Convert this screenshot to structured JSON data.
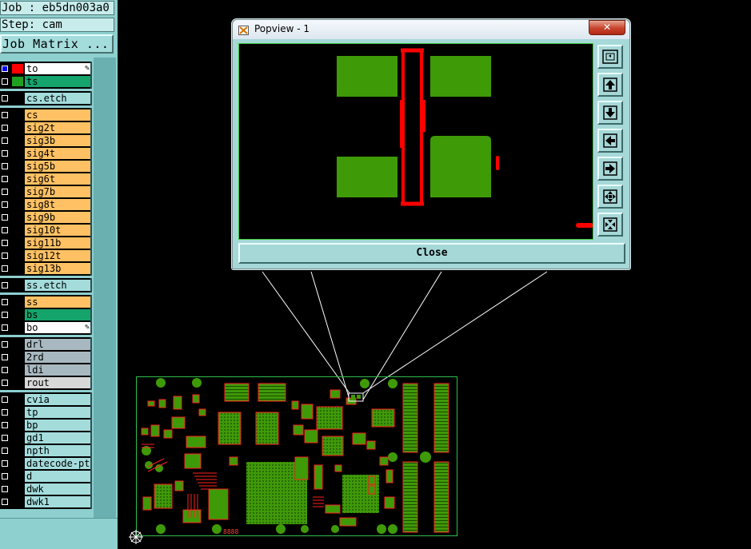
{
  "job_info": {
    "job": "Job : eb5dn003a0",
    "step": "Step: cam",
    "job_matrix_button": "Job Matrix ..."
  },
  "layers": [
    {
      "name": "to",
      "color": "white",
      "swatch": "#ff0000",
      "checkbox_color": "#0000ff",
      "editable": true
    },
    {
      "name": "ts",
      "color": "green",
      "swatch": "#20a020"
    },
    {
      "name": "cs.etch",
      "color": "cyan"
    },
    {
      "name": "cs",
      "color": "orange"
    },
    {
      "name": "sig2t",
      "color": "orange"
    },
    {
      "name": "sig3b",
      "color": "orange"
    },
    {
      "name": "sig4t",
      "color": "orange"
    },
    {
      "name": "sig5b",
      "color": "orange"
    },
    {
      "name": "sig6t",
      "color": "orange"
    },
    {
      "name": "sig7b",
      "color": "orange"
    },
    {
      "name": "sig8t",
      "color": "orange"
    },
    {
      "name": "sig9b",
      "color": "orange"
    },
    {
      "name": "sig10t",
      "color": "orange"
    },
    {
      "name": "sig11b",
      "color": "orange"
    },
    {
      "name": "sig12t",
      "color": "orange"
    },
    {
      "name": "sig13b",
      "color": "orange"
    },
    {
      "name": "ss.etch",
      "color": "cyan"
    },
    {
      "name": "ss",
      "color": "orange"
    },
    {
      "name": "bs",
      "color": "green"
    },
    {
      "name": "bo",
      "color": "white",
      "editable": true
    },
    {
      "name": "drl",
      "color": "grey"
    },
    {
      "name": "2rd",
      "color": "grey"
    },
    {
      "name": "ldi",
      "color": "grey"
    },
    {
      "name": "rout",
      "color": "lgrey"
    },
    {
      "name": "cvia",
      "color": "cyan"
    },
    {
      "name": "tp",
      "color": "cyan"
    },
    {
      "name": "bp",
      "color": "cyan"
    },
    {
      "name": "gd1",
      "color": "cyan"
    },
    {
      "name": "npth",
      "color": "cyan"
    },
    {
      "name": "datecode-pte",
      "color": "cyan"
    },
    {
      "name": "d",
      "color": "cyan"
    },
    {
      "name": "dwk",
      "color": "cyan"
    },
    {
      "name": "dwk1",
      "color": "cyan"
    }
  ],
  "popview": {
    "title": "Popview - 1",
    "title_close_glyph": "✕",
    "close_button": "Close",
    "tools": [
      "zoom-home-icon",
      "pan-up-icon",
      "pan-down-icon",
      "pan-left-icon",
      "pan-right-icon",
      "zoom-in-icon",
      "zoom-out-icon"
    ]
  },
  "board_marker": "8888",
  "colors": {
    "pad_green": "#3f9a07",
    "trace_red": "#ff0000",
    "board_outline": "#2fbf4f",
    "panel_bg": "#8ecfcf"
  }
}
